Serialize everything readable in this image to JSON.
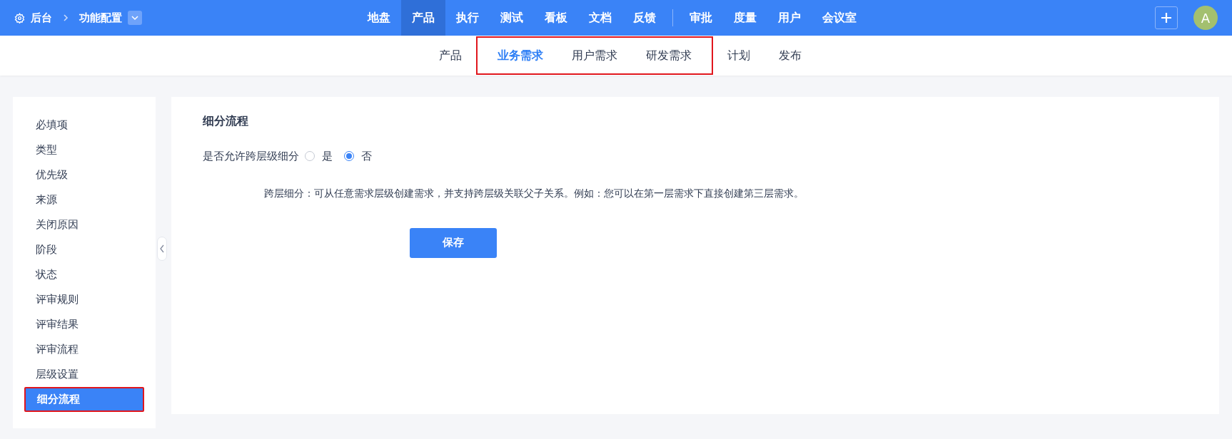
{
  "breadcrumb": {
    "root": "后台",
    "current": "功能配置"
  },
  "nav": {
    "primary": [
      {
        "label": "地盘",
        "selected": false
      },
      {
        "label": "产品",
        "selected": true
      },
      {
        "label": "执行",
        "selected": false
      },
      {
        "label": "测试",
        "selected": false
      },
      {
        "label": "看板",
        "selected": false
      },
      {
        "label": "文档",
        "selected": false
      },
      {
        "label": "反馈",
        "selected": false
      }
    ],
    "secondary": [
      {
        "label": "审批",
        "selected": false
      },
      {
        "label": "度量",
        "selected": false
      },
      {
        "label": "用户",
        "selected": false
      },
      {
        "label": "会议室",
        "selected": false
      }
    ]
  },
  "user": {
    "avatar": "A"
  },
  "subnav": [
    {
      "label": "产品",
      "selected": false,
      "highlighted": false
    },
    {
      "label": "业务需求",
      "selected": true,
      "highlighted": true
    },
    {
      "label": "用户需求",
      "selected": false,
      "highlighted": true
    },
    {
      "label": "研发需求",
      "selected": false,
      "highlighted": true
    },
    {
      "label": "计划",
      "selected": false,
      "highlighted": false
    },
    {
      "label": "发布",
      "selected": false,
      "highlighted": false
    }
  ],
  "sidebar": {
    "items": [
      {
        "label": "必填项",
        "selected": false
      },
      {
        "label": "类型",
        "selected": false
      },
      {
        "label": "优先级",
        "selected": false
      },
      {
        "label": "来源",
        "selected": false
      },
      {
        "label": "关闭原因",
        "selected": false
      },
      {
        "label": "阶段",
        "selected": false
      },
      {
        "label": "状态",
        "selected": false
      },
      {
        "label": "评审规则",
        "selected": false
      },
      {
        "label": "评审结果",
        "selected": false
      },
      {
        "label": "评审流程",
        "selected": false
      },
      {
        "label": "层级设置",
        "selected": false
      },
      {
        "label": "细分流程",
        "selected": true
      }
    ]
  },
  "content": {
    "title": "细分流程",
    "field_label": "是否允许跨层级细分",
    "options": [
      {
        "label": "是",
        "selected": false
      },
      {
        "label": "否",
        "selected": true
      }
    ],
    "note": "跨层细分：可从任意需求层级创建需求，并支持跨层级关联父子关系。例如：您可以在第一层需求下直接创建第三层需求。",
    "save_button": "保存"
  }
}
